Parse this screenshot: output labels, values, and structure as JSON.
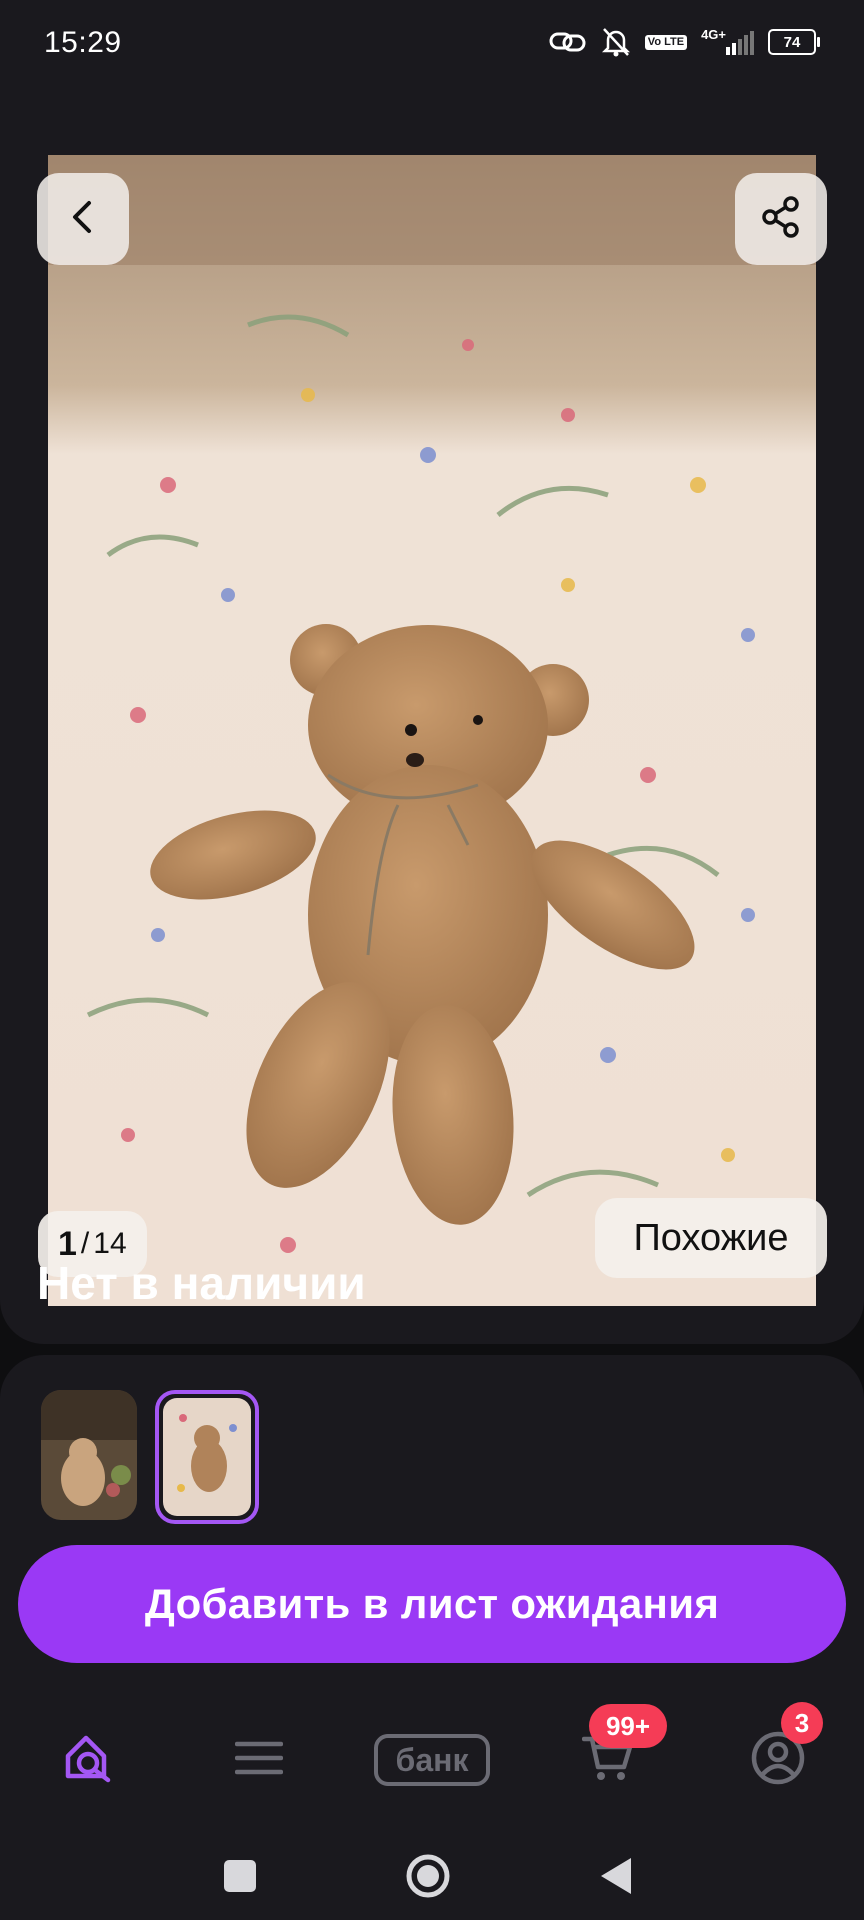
{
  "status_bar": {
    "time": "15:29",
    "volte": "Vo LTE",
    "network": "4G+",
    "battery": "74"
  },
  "gallery": {
    "current": "1",
    "separator": "/",
    "total": "14",
    "similar_label": "Похожие"
  },
  "product": {
    "availability": "Нет в наличии"
  },
  "action": {
    "waitlist_label": "Добавить в лист ожидания"
  },
  "bottom_nav": {
    "bank_label": "банк",
    "cart_badge": "99+",
    "profile_badge": "3",
    "active_color": "#a457f4",
    "inactive_color": "#6b6b74"
  },
  "colors": {
    "accent": "#9a39f5",
    "badge": "#f53c56",
    "background": "#1a191e"
  }
}
